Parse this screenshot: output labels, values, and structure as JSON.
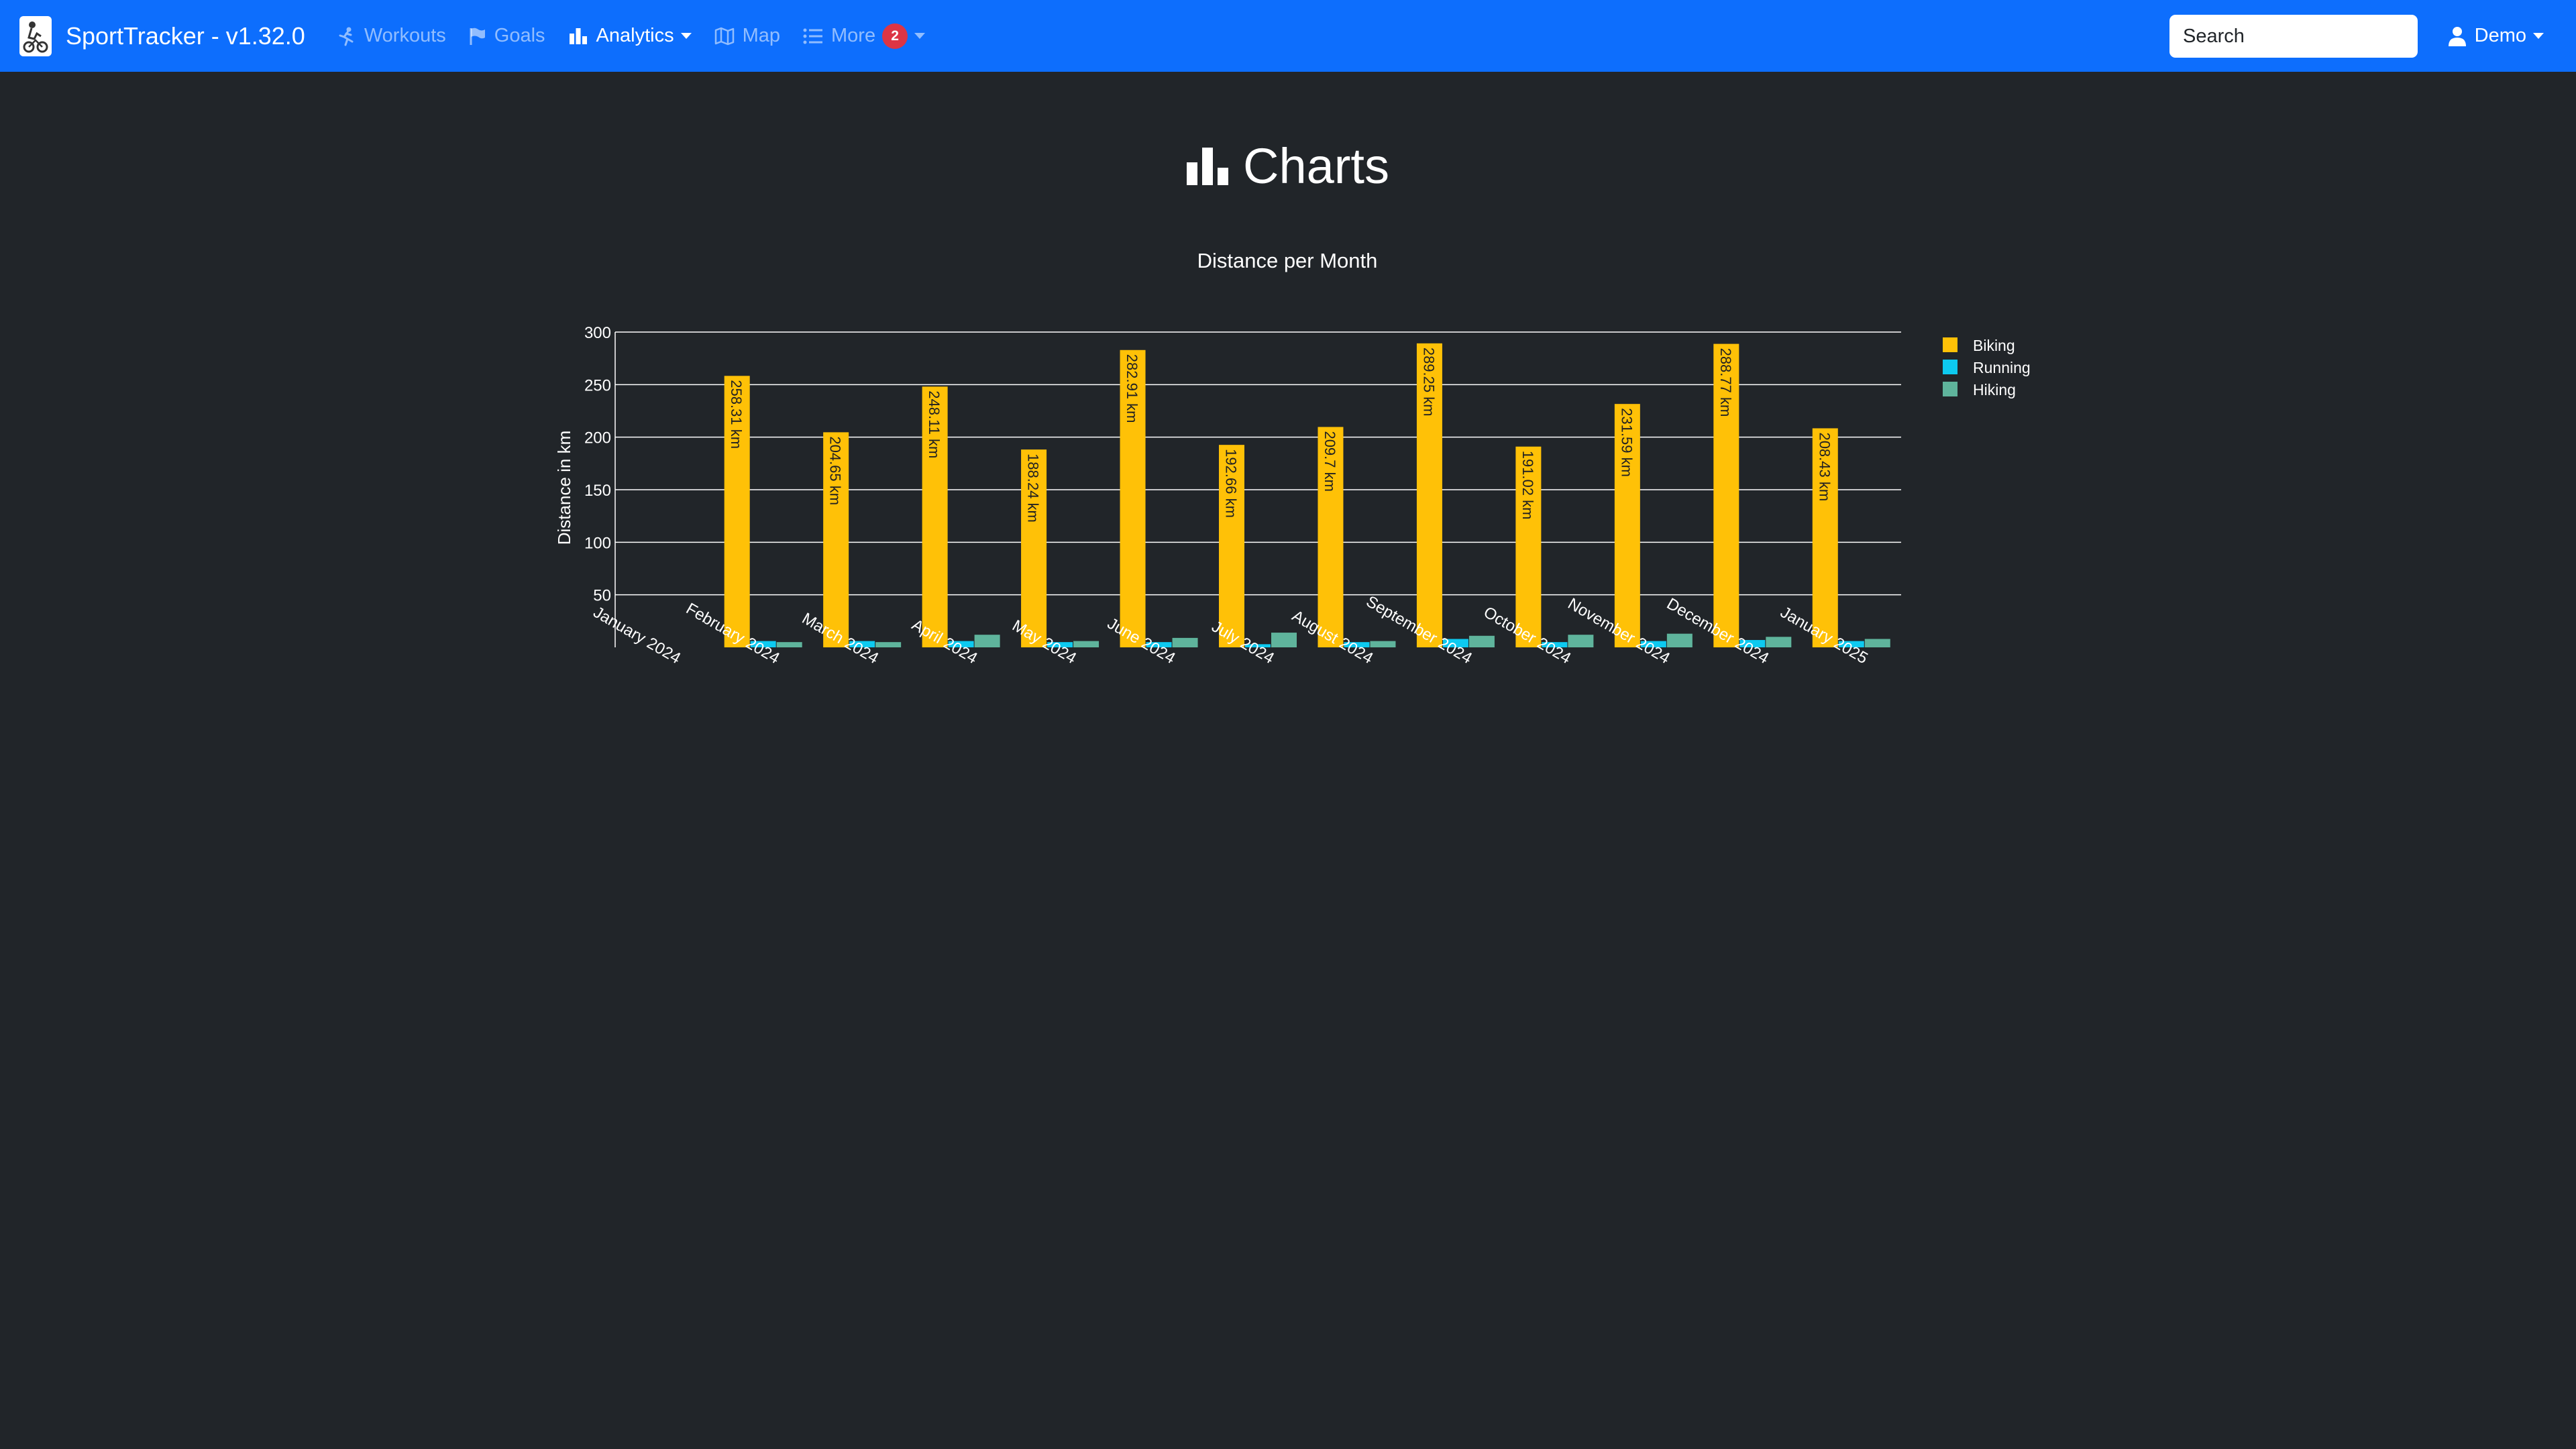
{
  "app": {
    "title": "SportTracker - v1.32.0",
    "logo_icon": "sport-tracker-logo-icon"
  },
  "nav": {
    "items": [
      {
        "label": "Workouts",
        "icon": "workout-icon",
        "active": false
      },
      {
        "label": "Goals",
        "icon": "flag-icon",
        "active": false
      },
      {
        "label": "Analytics",
        "icon": "bar-chart-icon",
        "active": true,
        "dropdown": true
      },
      {
        "label": "Map",
        "icon": "map-icon",
        "active": false
      },
      {
        "label": "More",
        "icon": "list-icon",
        "active": false,
        "dropdown": true,
        "badge": "2"
      }
    ]
  },
  "search": {
    "placeholder": "Search"
  },
  "user": {
    "name": "Demo",
    "icon": "user-icon"
  },
  "page": {
    "title": "Charts",
    "icon": "bar-chart-icon"
  },
  "chart_data": {
    "type": "bar",
    "title": "Distance per Month",
    "xlabel": "",
    "ylabel": "Distance in km",
    "ylim": [
      0,
      300
    ],
    "yticks": [
      50,
      100,
      150,
      200,
      250,
      300
    ],
    "grid": true,
    "legend_position": "top-right",
    "categories": [
      "January 2024",
      "February 2024",
      "March 2024",
      "April 2024",
      "May 2024",
      "June 2024",
      "July 2024",
      "August 2024",
      "September 2024",
      "October 2024",
      "November 2024",
      "December 2024",
      "January 2025"
    ],
    "label_suffix": " km",
    "series": [
      {
        "name": "Biking",
        "color": "#ffc107",
        "show_labels": true,
        "values": [
          null,
          258.31,
          204.65,
          248.11,
          188.24,
          282.91,
          192.66,
          209.7,
          289.25,
          191.02,
          231.59,
          288.77,
          208.43
        ]
      },
      {
        "name": "Running",
        "color": "#0dcaf0",
        "show_labels": false,
        "values": [
          null,
          6,
          6,
          6,
          5,
          5,
          3,
          5,
          8,
          5,
          6,
          7,
          6
        ]
      },
      {
        "name": "Hiking",
        "color": "#5fb49c",
        "show_labels": false,
        "values": [
          null,
          5,
          5,
          12,
          6,
          9,
          14,
          6,
          11,
          12,
          13,
          10,
          8
        ]
      }
    ]
  }
}
